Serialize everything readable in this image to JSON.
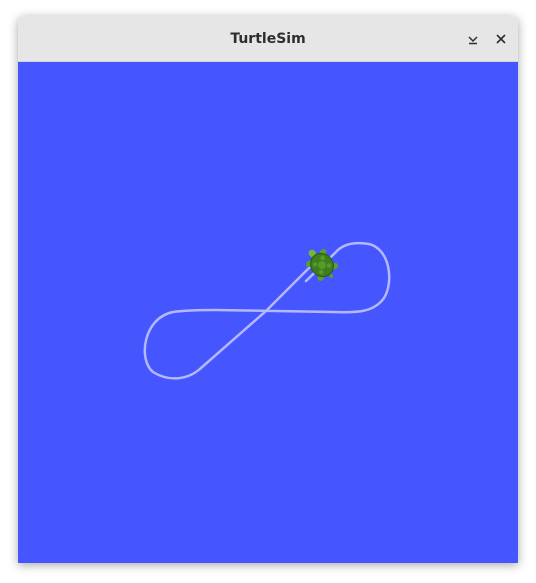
{
  "window": {
    "title": "TurtleSim",
    "minimize_icon": "minimize-icon",
    "close_icon": "close-icon"
  },
  "canvas": {
    "background_color": "#4556ff",
    "pen_color": "#b3b8ff",
    "turtle_icon": "turtle-icon"
  }
}
